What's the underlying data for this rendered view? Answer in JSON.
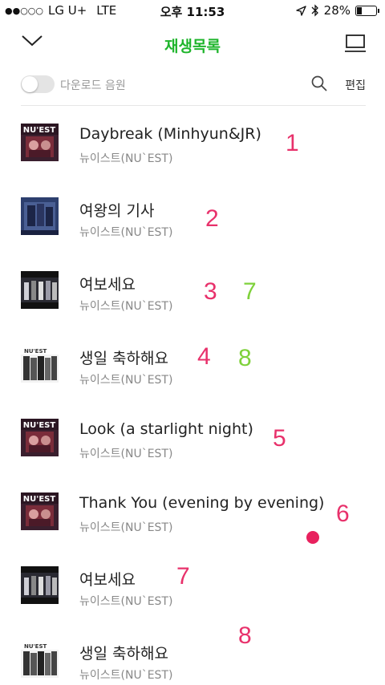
{
  "status_bar": {
    "carrier": "LG U+",
    "network": "LTE",
    "time": "오후 11:53",
    "battery": "28%",
    "battery_level": 0.28
  },
  "header": {
    "title": "재생목록",
    "back_icon": "chevron-down-icon",
    "queue_icon": "queue-icon"
  },
  "subbar": {
    "download_label": "다운로드 음원",
    "edit_label": "편집"
  },
  "colors": {
    "accent": "#1fb52c",
    "annotation_pink": "#e8316b",
    "annotation_green": "#7ed13a"
  },
  "songs": [
    {
      "title": "Daybreak (Minhyun&JR)",
      "artist": "뉴이스트(NU`EST)",
      "cover": "a"
    },
    {
      "title": "여왕의 기사",
      "artist": "뉴이스트(NU`EST)",
      "cover": "b"
    },
    {
      "title": "여보세요",
      "artist": "뉴이스트(NU`EST)",
      "cover": "c"
    },
    {
      "title": "생일 축하해요",
      "artist": "뉴이스트(NU`EST)",
      "cover": "d"
    },
    {
      "title": "Look (a starlight night)",
      "artist": "뉴이스트(NU`EST)",
      "cover": "a"
    },
    {
      "title": "Thank You (evening by evening)",
      "artist": "뉴이스트(NU`EST)",
      "cover": "a"
    },
    {
      "title": "여보세요",
      "artist": "뉴이스트(NU`EST)",
      "cover": "c"
    },
    {
      "title": "생일 축하해요",
      "artist": "뉴이스트(NU`EST)",
      "cover": "d"
    }
  ],
  "annotations": {
    "n1": "1",
    "n2": "2",
    "n3": "3",
    "n4": "4",
    "n5": "5",
    "n6": "6",
    "n7": "7",
    "n8": "8",
    "g7": "7",
    "g8": "8"
  }
}
